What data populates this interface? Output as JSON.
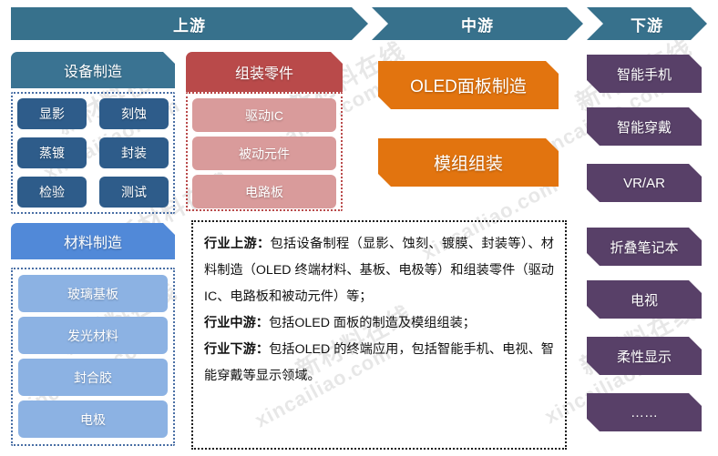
{
  "banner": {
    "segments": [
      {
        "label": "上游",
        "name": "upstream"
      },
      {
        "label": "中游",
        "name": "midstream"
      },
      {
        "label": "下游",
        "name": "downstream"
      }
    ]
  },
  "upstream": {
    "equipment": {
      "title": "设备制造",
      "items": [
        "显影",
        "刻蚀",
        "蒸镀",
        "封装",
        "检验",
        "测试"
      ]
    },
    "material": {
      "title": "材料制造",
      "items": [
        "玻璃基板",
        "发光材料",
        "封合胶",
        "电极"
      ]
    },
    "assembly": {
      "title": "组装零件",
      "items": [
        "驱动IC",
        "被动元件",
        "电路板"
      ]
    }
  },
  "midstream": {
    "items": [
      "OLED面板制造",
      "模组组装"
    ]
  },
  "downstream": {
    "items": [
      "智能手机",
      "智能穿戴",
      "VR/AR",
      "折叠笔记本",
      "电视",
      "柔性显示",
      "……"
    ]
  },
  "description": {
    "upstream_label": "行业上游：",
    "upstream_text": "包括设备制程（显影、蚀刻、镀膜、封装等）、材料制造（OLED 终端材料、基板、电极等）和组装零件（驱动 IC、电路板和被动元件）等；",
    "midstream_label": "行业中游：",
    "midstream_text": "包括OLED 面板的制造及模组组装；",
    "downstream_label": "行业下游：",
    "downstream_text": "包括OLED 的终端应用，包括智能手机、电视、智能穿戴等显示领域。"
  },
  "watermarks": {
    "cn": "新材料在线",
    "en": "xincailiao.com"
  },
  "colors": {
    "banner_teal": "#37718C",
    "header_teal": "#3A7392",
    "header_red": "#B94A4A",
    "header_blue": "#5189D8",
    "chip_navy": "#2E5C8A",
    "chip_light_red": "#D99B9B",
    "chip_light_blue": "#8CB2E3",
    "midstream_orange": "#E2740F",
    "downstream_purple": "#584068"
  }
}
